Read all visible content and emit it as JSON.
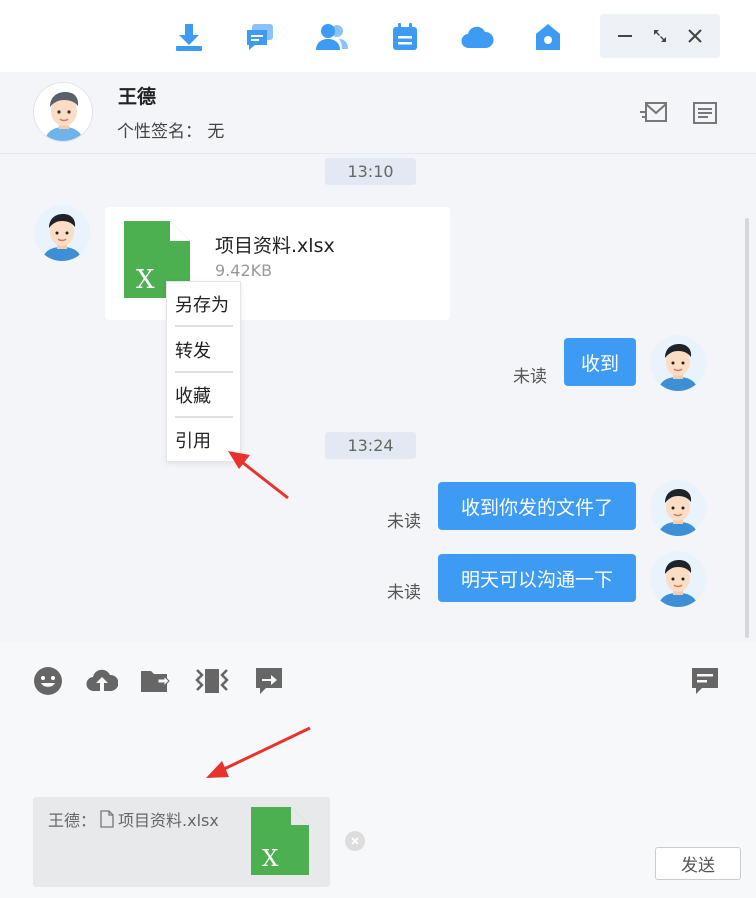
{
  "colors": {
    "accent": "#3d9bf3",
    "excel_green": "#4caf50",
    "arrow_red": "#e8322b"
  },
  "toolbar": {
    "icons": [
      "download-icon",
      "chat-icon",
      "contacts-icon",
      "calendar-icon",
      "cloud-icon",
      "home-icon"
    ],
    "window_controls": [
      "minimize-icon",
      "fullscreen-icon",
      "close-icon"
    ]
  },
  "contact": {
    "name": "王德",
    "signature": "个性签名： 无"
  },
  "messages": {
    "time1": "13:10",
    "file": {
      "name": "项目资料.xlsx",
      "size": "9.42KB",
      "icon_letter": "X"
    },
    "context_menu": [
      "另存为",
      "转发",
      "收藏",
      "引用"
    ],
    "reply1": {
      "status": "未读",
      "text": "收到"
    },
    "time2": "13:24",
    "reply2": {
      "status": "未读",
      "text": "收到你发的文件了"
    },
    "reply3": {
      "status": "未读",
      "text": "明天可以沟通一下"
    }
  },
  "input": {
    "tool_icons": [
      "emoji-icon",
      "upload-cloud-icon",
      "send-folder-icon",
      "screenshot-icon",
      "forward-icon"
    ],
    "quote": {
      "sender": "王德：",
      "file_name": "项目资料.xlsx",
      "icon_letter": "X"
    },
    "send_label": "发送"
  }
}
